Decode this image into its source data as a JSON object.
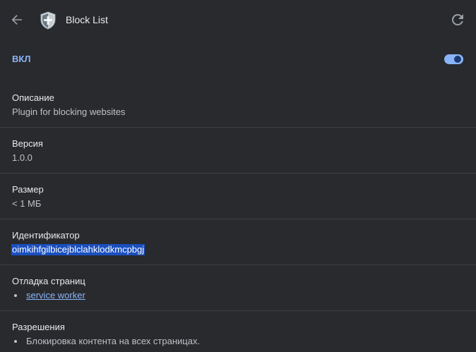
{
  "header": {
    "title": "Block List",
    "back_icon": "arrow-back-icon",
    "extension_icon": "shield-icon",
    "reload_icon": "reload-icon"
  },
  "toggle": {
    "label": "ВКЛ",
    "enabled": true
  },
  "sections": {
    "description": {
      "title": "Описание",
      "value": "Plugin for blocking websites"
    },
    "version": {
      "title": "Версия",
      "value": "1.0.0"
    },
    "size": {
      "title": "Размер",
      "value": "< 1 МБ"
    },
    "id": {
      "title": "Идентификатор",
      "value": "oimkihfgilbicejblclahklodkmcpbgj"
    },
    "inspect_views": {
      "title": "Отладка страниц",
      "items": [
        "service worker"
      ]
    },
    "permissions": {
      "title": "Разрешения",
      "items": [
        "Блокировка контента на всех страницах."
      ]
    }
  },
  "colors": {
    "background": "#292a2d",
    "accent": "#8ab4f8",
    "divider": "#3c4043",
    "selection": "#1a4fbf"
  }
}
